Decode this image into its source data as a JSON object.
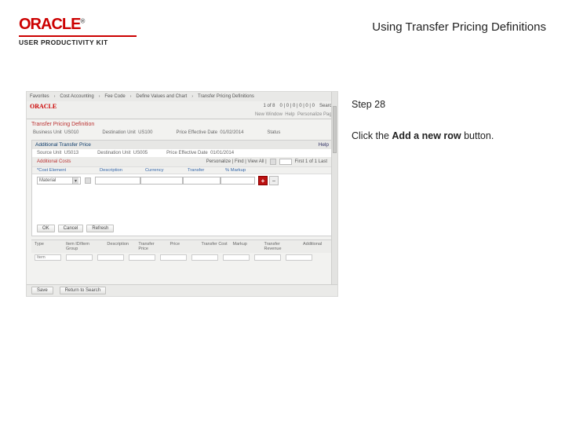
{
  "brand": {
    "logo": "ORACLE",
    "product": "USER PRODUCTIVITY KIT"
  },
  "title": "Using Transfer Pricing Definitions",
  "instruction": {
    "step": "Step 28",
    "text_pre": "Click the ",
    "bold": "Add a new row",
    "text_post": " button."
  },
  "shot": {
    "topbar": {
      "items": [
        "Favorites",
        "Cost Accounting",
        "Fee Code",
        "Define Values and Chart",
        "Transfer Pricing Definitions"
      ],
      "right": [
        "1 of 8",
        "0 | 0 | 0 | 0 | 0 | 0",
        "Search"
      ]
    },
    "brandrow": {
      "logo": "ORACLE",
      "right": [
        "New Window",
        "Help",
        "Personalize Page"
      ]
    },
    "crumbs": "",
    "pageHeader": {
      "title": "Transfer Pricing Definition"
    },
    "info1": {
      "bu_label": "Business Unit",
      "bu": "US010",
      "du_label": "Destination Unit",
      "du": "US100",
      "eff_label": "Price Effective Date",
      "eff": "01/02/2014",
      "status_label": "Status"
    },
    "panel": {
      "title": "Additional Transfer Price",
      "help": "Help",
      "info2": {
        "su_label": "Source Unit",
        "su": "US013",
        "du_label": "Destination Unit",
        "du": "US005",
        "eff_label": "Price Effective Date",
        "eff": "01/01/2014"
      },
      "sub": {
        "left": "Additional Costs",
        "right": {
          "label": "Personalize | Find | View All |",
          "rowinfo": "First 1 of 1 Last"
        }
      },
      "grid": {
        "cols": [
          "*Cost Element",
          "",
          "Description",
          "Currency",
          "Transfer",
          "% Markup"
        ],
        "row": {
          "costel": "Material",
          "plus": "+",
          "minus": "−"
        }
      },
      "buttons": [
        "OK",
        "Cancel",
        "Refresh"
      ]
    },
    "lower": {
      "hdr": [
        "Type",
        "Item ID/Item Group",
        "Description",
        "Transfer Price",
        "Price",
        "Transfer Cost",
        "Markup",
        "Transfer Revenue",
        "Additional"
      ],
      "row": {
        "type": "Item"
      }
    },
    "footer": {
      "save": "Save",
      "return": "Return to Search"
    }
  }
}
